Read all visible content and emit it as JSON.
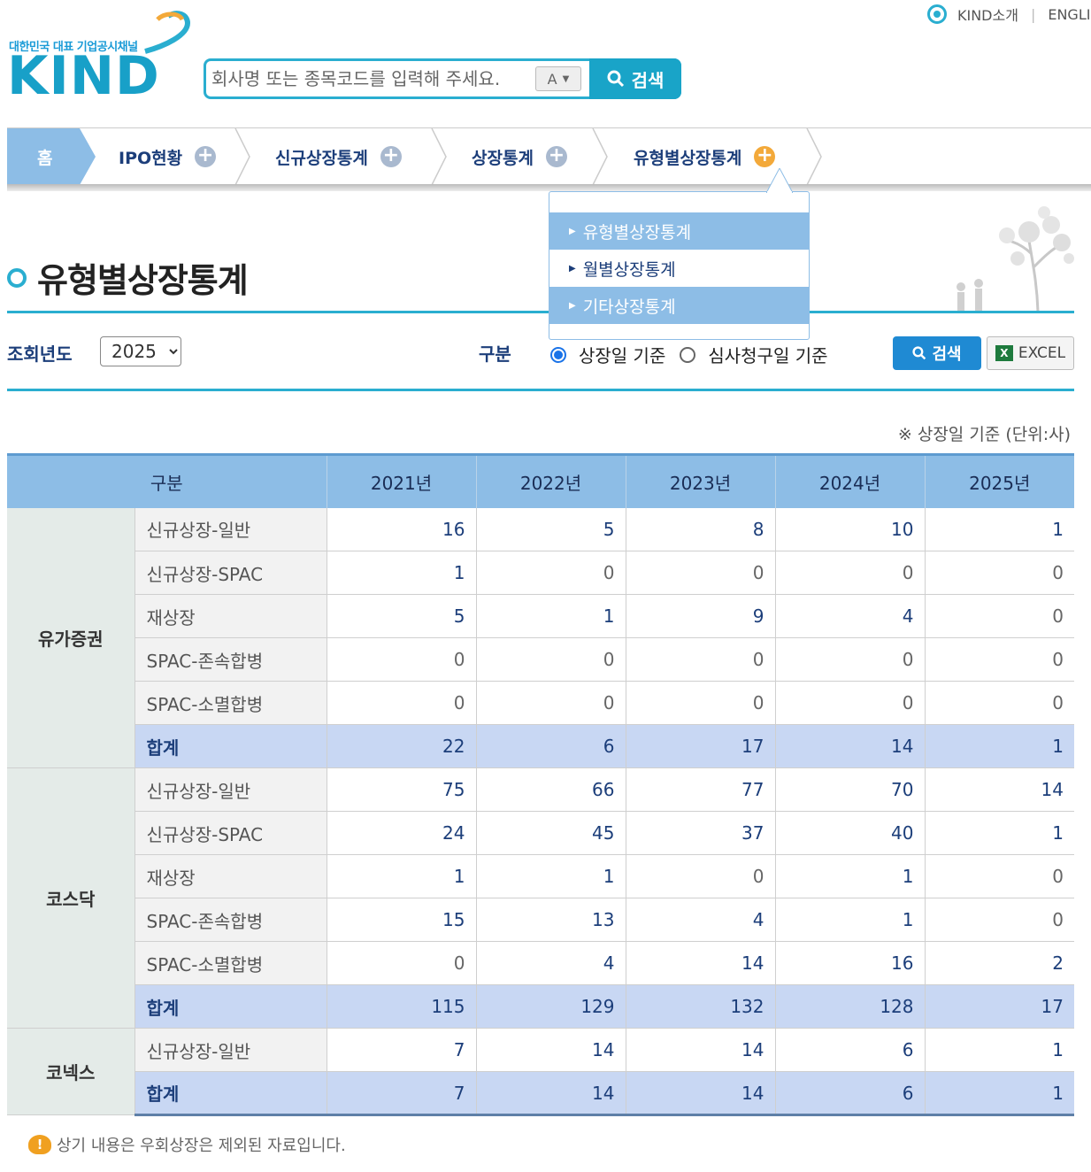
{
  "logo": {
    "tagline": "대한민국 대표 기업공시채널",
    "brand": "KIND"
  },
  "search": {
    "placeholder": "회사명 또는 종목코드를 입력해 주세요.",
    "font_toggle": "A",
    "button_label": "검색"
  },
  "top_links": {
    "about": "KIND소개",
    "english": "ENGLI"
  },
  "nav": {
    "home": "홈",
    "items": [
      {
        "label": "IPO현황"
      },
      {
        "label": "신규상장통계"
      },
      {
        "label": "상장통계"
      },
      {
        "label": "유형별상장통계"
      }
    ]
  },
  "dropdown": {
    "items": [
      {
        "label": "유형별상장통계"
      },
      {
        "label": "월별상장통계"
      },
      {
        "label": "기타상장통계"
      }
    ]
  },
  "page": {
    "title": "유형별상장통계"
  },
  "filters": {
    "year_label": "조회년도",
    "year_value": "2025",
    "type_label": "구분",
    "radio_listing": "상장일 기준",
    "radio_request": "심사청구일 기준",
    "search_button": "검색",
    "excel_button": "EXCEL"
  },
  "unit_note": "※ 상장일 기준 (단위:사)",
  "table": {
    "headers": [
      "구분",
      "2021년",
      "2022년",
      "2023년",
      "2024년",
      "2025년"
    ],
    "groups": [
      {
        "name": "유가증권",
        "rows": [
          {
            "label": "신규상장-일반",
            "values": [
              "16",
              "5",
              "8",
              "10",
              "1"
            ]
          },
          {
            "label": "신규상장-SPAC",
            "values": [
              "1",
              "0",
              "0",
              "0",
              "0"
            ]
          },
          {
            "label": "재상장",
            "values": [
              "5",
              "1",
              "9",
              "4",
              "0"
            ]
          },
          {
            "label": "SPAC-존속합병",
            "values": [
              "0",
              "0",
              "0",
              "0",
              "0"
            ]
          },
          {
            "label": "SPAC-소멸합병",
            "values": [
              "0",
              "0",
              "0",
              "0",
              "0"
            ]
          },
          {
            "label": "합계",
            "values": [
              "22",
              "6",
              "17",
              "14",
              "1"
            ],
            "total": true
          }
        ]
      },
      {
        "name": "코스닥",
        "rows": [
          {
            "label": "신규상장-일반",
            "values": [
              "75",
              "66",
              "77",
              "70",
              "14"
            ]
          },
          {
            "label": "신규상장-SPAC",
            "values": [
              "24",
              "45",
              "37",
              "40",
              "1"
            ]
          },
          {
            "label": "재상장",
            "values": [
              "1",
              "1",
              "0",
              "1",
              "0"
            ]
          },
          {
            "label": "SPAC-존속합병",
            "values": [
              "15",
              "13",
              "4",
              "1",
              "0"
            ]
          },
          {
            "label": "SPAC-소멸합병",
            "values": [
              "0",
              "4",
              "14",
              "16",
              "2"
            ]
          },
          {
            "label": "합계",
            "values": [
              "115",
              "129",
              "132",
              "128",
              "17"
            ],
            "total": true
          }
        ]
      },
      {
        "name": "코넥스",
        "rows": [
          {
            "label": "신규상장-일반",
            "values": [
              "7",
              "14",
              "14",
              "6",
              "1"
            ]
          },
          {
            "label": "합계",
            "values": [
              "7",
              "14",
              "14",
              "6",
              "1"
            ],
            "total": true
          }
        ]
      }
    ]
  },
  "footnote": "상기 내용은 우회상장은 제외된 자료입니다.",
  "colors": {
    "accent": "#2aaed0",
    "nav_highlight": "#8dbde6",
    "total_row": "#c8d7f3",
    "link_blue": "#1c3e7a"
  }
}
